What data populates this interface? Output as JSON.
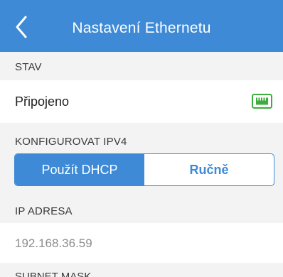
{
  "header": {
    "title": "Nastavení Ethernetu",
    "back_icon": "chevron-left-icon"
  },
  "status": {
    "section_label": "STAV",
    "value": "Připojeno",
    "icon": "ethernet-port-icon",
    "icon_color": "#3cae3c"
  },
  "ipv4": {
    "section_label": "KONFIGUROVAT IPV4",
    "options": [
      "Použít DHCP",
      "Ručně"
    ],
    "selected": "Použít DHCP"
  },
  "ip_address": {
    "section_label": "IP ADRESA",
    "value": "192.168.36.59"
  },
  "next_section": {
    "section_label": "SUBNET MASK"
  },
  "colors": {
    "accent": "#3e8ad6",
    "background": "#f3f3f4",
    "row": "#ffffff",
    "connected": "#3cae3c"
  }
}
